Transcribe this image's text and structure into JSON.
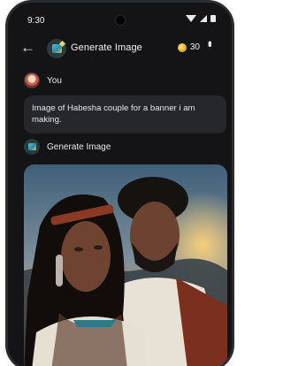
{
  "status_bar": {
    "time": "9:30"
  },
  "app_bar": {
    "title": "Generate Image",
    "credits": "30"
  },
  "conversation": {
    "user_name": "You",
    "user_prompt": "Image of Habesha couple for a banner i am making.",
    "bot_name": "Generate Image"
  },
  "colors": {
    "background": "#141416",
    "bubble": "#26272b",
    "coin": "#e2a813"
  },
  "icons": [
    "wifi-icon",
    "signal-icon",
    "battery-icon",
    "back-arrow-icon",
    "image-generator-icon",
    "coin-icon",
    "more-vert-icon"
  ]
}
